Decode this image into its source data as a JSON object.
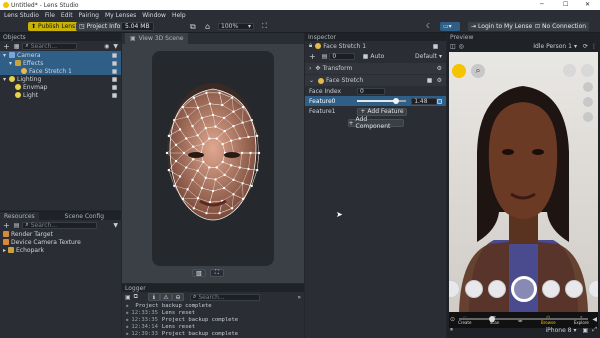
{
  "titlebar": {
    "title": "Untitled* - Lens Studio"
  },
  "menu": [
    "Lens Studio",
    "File",
    "Edit",
    "Pairing",
    "My Lenses",
    "Window",
    "Help"
  ],
  "toolbar": {
    "publish": "Publish Lens",
    "project_info": "Project Info",
    "size": "5.04 MB",
    "zoom": "100%",
    "login": "Login to My Lenses",
    "connection": "No Connection"
  },
  "objects": {
    "title": "Objects",
    "search_placeholder": "Search...",
    "items": [
      {
        "label": "Camera",
        "indent": 0,
        "icon": "camera-icon",
        "selected": true
      },
      {
        "label": "Effects",
        "indent": 1,
        "icon": "folder-icon",
        "selected": true
      },
      {
        "label": "Face Stretch 1",
        "indent": 2,
        "icon": "face-icon",
        "selected": true
      },
      {
        "label": "Lighting",
        "indent": 0,
        "icon": "bulb-icon",
        "selected": false
      },
      {
        "label": "Envmap",
        "indent": 1,
        "icon": "bulb-icon",
        "selected": false
      },
      {
        "label": "Light",
        "indent": 1,
        "icon": "bulb-icon",
        "selected": false
      }
    ]
  },
  "resources": {
    "tabs": [
      "Resources",
      "Scene Config"
    ],
    "search_placeholder": "Search...",
    "items": [
      "Render Target",
      "Device Camera Texture",
      "Echopark"
    ]
  },
  "scene": {
    "tab": "View 3D Scene"
  },
  "logger": {
    "title": "Logger",
    "search_placeholder": "Search...",
    "lines": [
      {
        "time": "",
        "text": "Project backup complete"
      },
      {
        "time": "12:33:35",
        "text": "Lens reset"
      },
      {
        "time": "12:33:35",
        "text": "Project backup complete"
      },
      {
        "time": "12:34:14",
        "text": "Lens reset"
      },
      {
        "time": "12:39:33",
        "text": "Project backup complete"
      }
    ]
  },
  "inspector": {
    "title": "Inspector",
    "object": "Face Stretch 1",
    "layer": "0",
    "auto": "Auto",
    "default": "Default",
    "transform": "Transform",
    "face_stretch": "Face Stretch",
    "face_index_label": "Face Index",
    "face_index": "0",
    "feature_label": "Feature0",
    "feature_value": "1.48",
    "feature_slider": 0.8,
    "feature1": "Feature1",
    "add_feature": "Add Feature",
    "add_component": "Add Component"
  },
  "preview": {
    "title": "Preview",
    "person": "Idle Person 1",
    "device": "iPhone 8",
    "nav": [
      "Create",
      "Scan",
      "",
      "Browse",
      "Explore"
    ]
  },
  "colors": {
    "accent": "#2f5f86",
    "publish": "#c8b400",
    "highlight": "#3a80c0"
  }
}
